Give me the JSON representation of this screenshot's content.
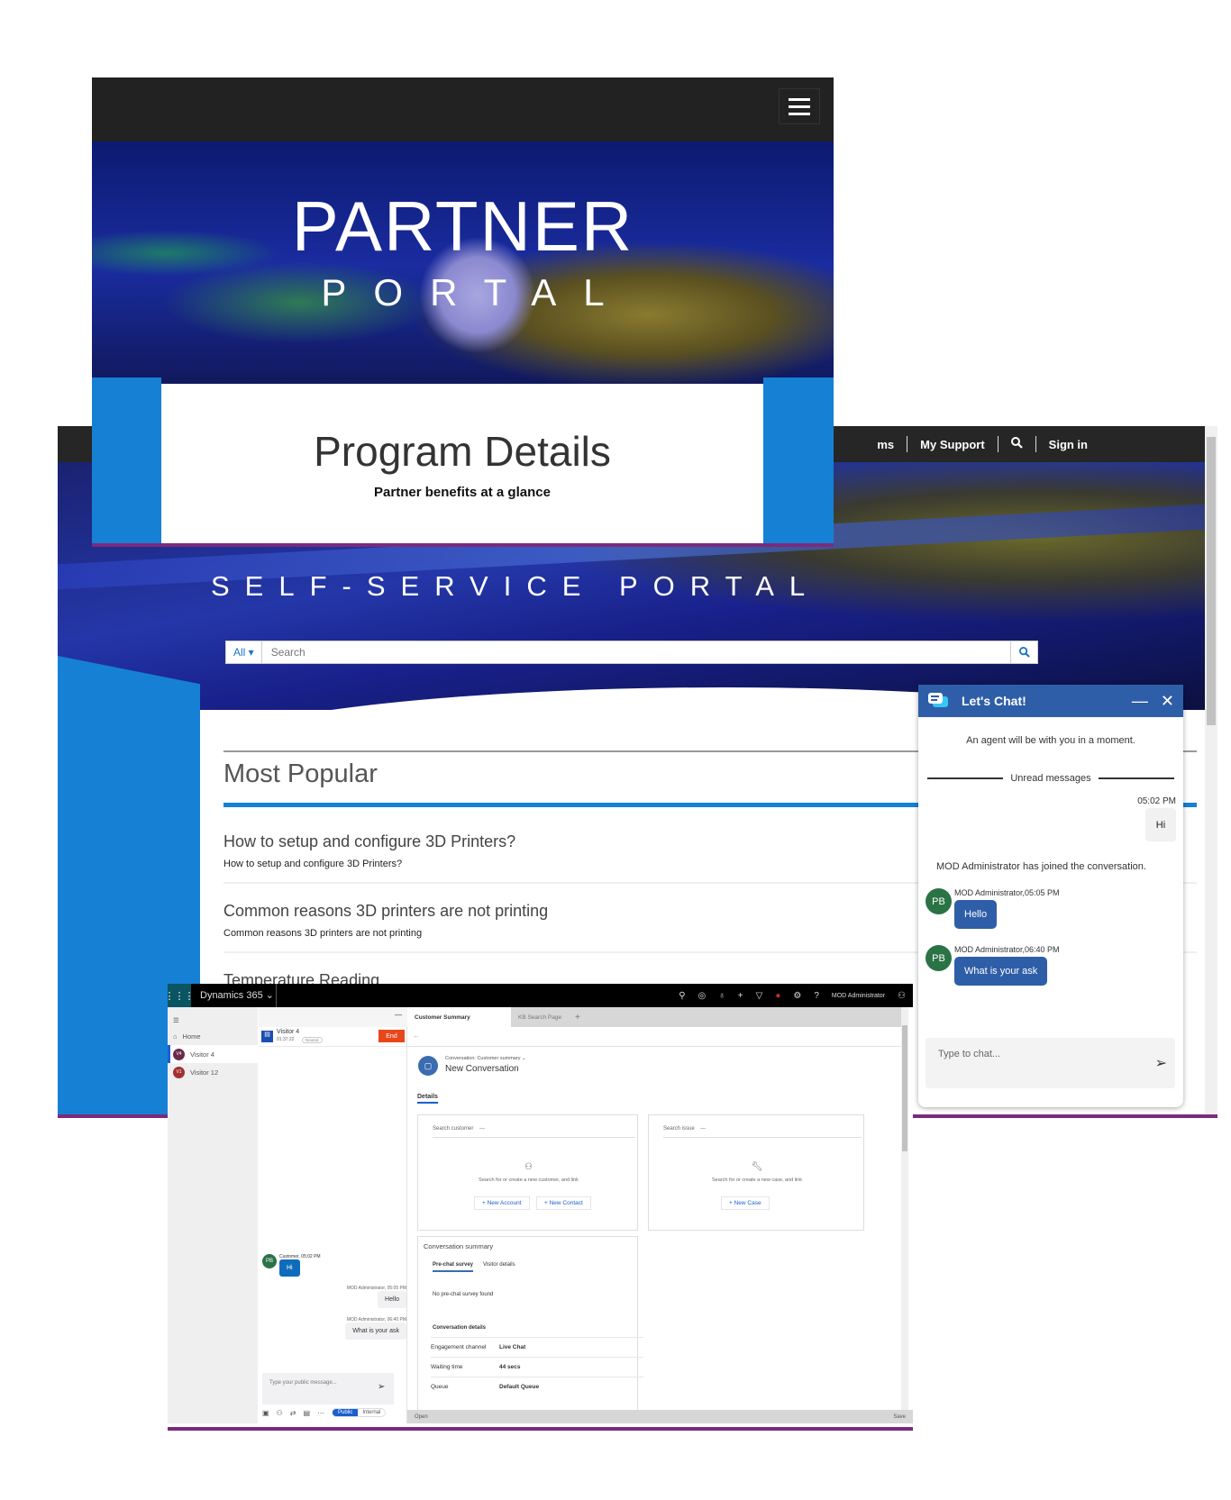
{
  "self_service": {
    "nav": {
      "items": [
        "ms",
        "My Support",
        "Sign in"
      ],
      "search_icon": "search-icon"
    },
    "hero_title": "SELF-SERVICE PORTAL",
    "search": {
      "filter": "All",
      "placeholder": "Search"
    },
    "section_title": "Most Popular",
    "articles": [
      {
        "title": "How to setup and configure 3D Printers?",
        "desc": "How to setup and configure 3D Printers?"
      },
      {
        "title": "Common reasons 3D printers are not printing",
        "desc": "Common reasons 3D printers are not printing"
      },
      {
        "title": "Temperature Reading",
        "desc": ""
      }
    ]
  },
  "partner": {
    "hero_title": "PARTNER",
    "hero_subtitle": "PORTAL",
    "page_title": "Program Details",
    "page_subtitle": "Partner benefits at a glance"
  },
  "chat_widget": {
    "title": "Let's Chat!",
    "notice": "An agent will be with you in a moment.",
    "unread_label": "Unread messages",
    "messages": [
      {
        "time": "05:02 PM",
        "text": "Hi"
      },
      {
        "system": "MOD Administrator has joined the conversation."
      },
      {
        "initials": "PB",
        "meta": "MOD Administrator,05:05 PM",
        "text": "Hello"
      },
      {
        "initials": "PB",
        "meta": "MOD Administrator,06:40 PM",
        "text": "What is your ask"
      }
    ],
    "input_placeholder": "Type to chat...",
    "accent": "#2f5ea8"
  },
  "dynamics": {
    "app_name": "Dynamics 365",
    "user": "MOD Administrator",
    "nav": [
      {
        "label": "Home"
      },
      {
        "label": "Visitor 4",
        "initials": "V4",
        "color": "#6b2a4a"
      },
      {
        "label": "Visitor 12",
        "initials": "V1",
        "color": "#a33030"
      }
    ],
    "session": {
      "name": "Visitor 4",
      "timer": "01:37:22",
      "sentiment": "Neutral",
      "end_label": "End"
    },
    "messages": [
      {
        "meta": "Customer, 05:02 PM",
        "initials": "PB",
        "text": "Hi"
      },
      {
        "meta": "MOD Administrator, 05:05 PM",
        "text": "Hello"
      },
      {
        "meta": "MOD Administrator, 06:40 PM",
        "text": "What is your ask"
      }
    ],
    "compose_placeholder": "Type your public message...",
    "compose_modes": [
      "Public",
      "Internal"
    ],
    "tabs": [
      "Customer Summary",
      "KB Search Page"
    ],
    "conversation": {
      "form": "Conversation: Customer summary",
      "title": "New Conversation"
    },
    "details_tab": "Details",
    "customer_card": {
      "label": "Search customer",
      "value": "---",
      "hint": "Search for or create a new customer, and link",
      "buttons": [
        "+ New Account",
        "+ New Contact"
      ]
    },
    "issue_card": {
      "label": "Search issue",
      "value": "---",
      "hint": "Search for or create a new case, and link",
      "buttons": [
        "+ New Case"
      ]
    },
    "summary": {
      "title": "Conversation summary",
      "tabs": [
        "Pre-chat survey",
        "Visitor details"
      ],
      "empty": "No pre-chat survey found",
      "details_title": "Conversation details",
      "rows": [
        {
          "label": "Engagement channel",
          "value": "Live Chat"
        },
        {
          "label": "Waiting time",
          "value": "44 secs"
        },
        {
          "label": "Queue",
          "value": "Default Queue"
        }
      ]
    },
    "status": {
      "left": "Open",
      "right": "Save"
    }
  }
}
